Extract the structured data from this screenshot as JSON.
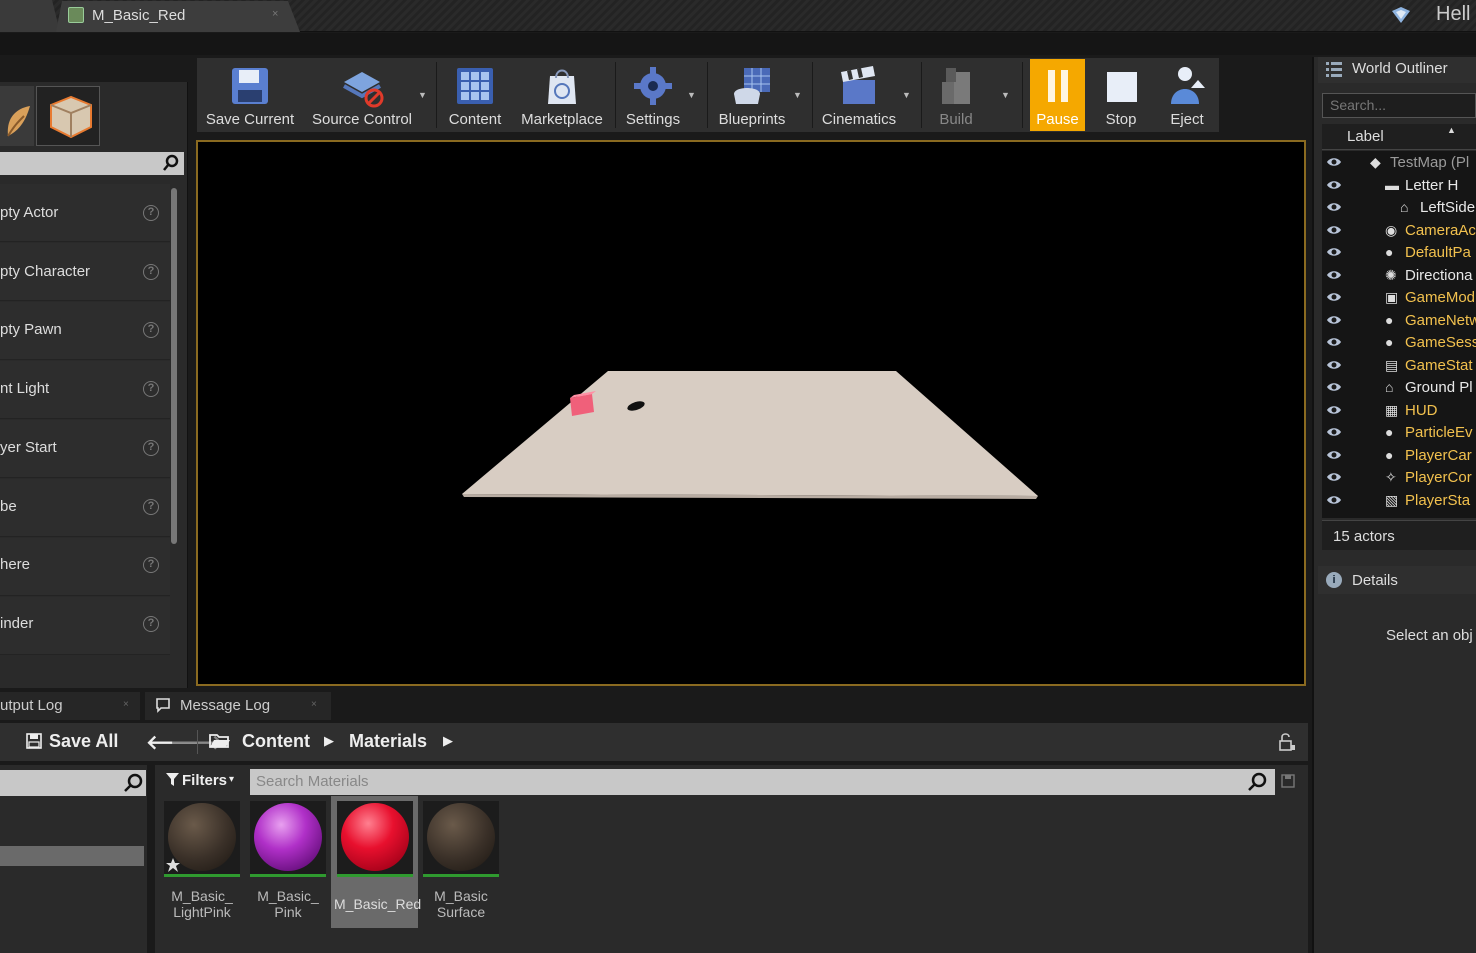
{
  "window": {
    "tab_title": "M_Basic_Red",
    "tab_close": "×",
    "user_greeting": "Hell"
  },
  "modes": {
    "items": [
      {
        "label": "pty Actor"
      },
      {
        "label": "pty Character"
      },
      {
        "label": "pty Pawn"
      },
      {
        "label": "nt Light"
      },
      {
        "label": "yer Start"
      },
      {
        "label": "be"
      },
      {
        "label": "here"
      },
      {
        "label": "inder"
      }
    ],
    "help_glyph": "?"
  },
  "toolbar": {
    "save_current": "Save Current",
    "source_control": "Source Control",
    "content": "Content",
    "marketplace": "Marketplace",
    "settings": "Settings",
    "blueprints": "Blueprints",
    "cinematics": "Cinematics",
    "build": "Build",
    "pause": "Pause",
    "stop": "Stop",
    "eject": "Eject",
    "dropdown_glyph": "▼"
  },
  "outliner": {
    "title": "World Outliner",
    "search_placeholder": "Search...",
    "column_label": "Label",
    "sort_glyph": "▲",
    "rows": [
      {
        "label": "TestMap (Pl",
        "icon": "map-icon",
        "color": "#9a9a9a"
      },
      {
        "label": "Letter H",
        "icon": "folder-icon",
        "color": "#e8e8e8"
      },
      {
        "label": "LeftSide",
        "icon": "actor-icon",
        "color": "#e8e8e8"
      },
      {
        "label": "CameraAc",
        "icon": "camera-icon",
        "color": "#f2c14e"
      },
      {
        "label": "DefaultPa",
        "icon": "pawn-icon",
        "color": "#f2c14e"
      },
      {
        "label": "Directiona",
        "icon": "sun-icon",
        "color": "#e8e8e8"
      },
      {
        "label": "GameMod",
        "icon": "gamemode-icon",
        "color": "#f2c14e"
      },
      {
        "label": "GameNetw",
        "icon": "sphere-icon",
        "color": "#f2c14e"
      },
      {
        "label": "GameSess",
        "icon": "sphere-icon",
        "color": "#f2c14e"
      },
      {
        "label": "GameStat",
        "icon": "chart-icon",
        "color": "#f2c14e"
      },
      {
        "label": "Ground Pl",
        "icon": "actor-icon",
        "color": "#e8e8e8"
      },
      {
        "label": "HUD",
        "icon": "hud-icon",
        "color": "#f2c14e"
      },
      {
        "label": "ParticleEv",
        "icon": "sphere-icon",
        "color": "#f2c14e"
      },
      {
        "label": "PlayerCar",
        "icon": "sphere-icon",
        "color": "#f2c14e"
      },
      {
        "label": "PlayerCor",
        "icon": "controller-icon",
        "color": "#f2c14e"
      },
      {
        "label": "PlayerSta",
        "icon": "state-icon",
        "color": "#f2c14e"
      }
    ],
    "actor_count": "15 actors"
  },
  "details": {
    "title": "Details",
    "empty_message": "Select an obj"
  },
  "bottom_tabs": {
    "output_log": "utput Log",
    "message_log": "Message Log",
    "close_glyph": "×"
  },
  "content_browser": {
    "save_all": "Save All",
    "back_glyph": "🡐",
    "forward_glyph": "🡒",
    "breadcrumb": [
      "Content",
      "Materials"
    ],
    "arrow_glyph": "▶",
    "filters": "Filters",
    "filters_caret": "▾",
    "search_placeholder": "Search Materials",
    "assets": [
      {
        "label": "M_Basic_\nLightPink",
        "color": "#3a3028"
      },
      {
        "label": "M_Basic_\nPink",
        "color": "#9a20b0"
      },
      {
        "label": "M_Basic_Red",
        "color": "#e01030"
      },
      {
        "label": "M_Basic\nSurface",
        "color": "#3a3028"
      }
    ]
  },
  "colors": {
    "accent_pause": "#f5a800",
    "viewport_border": "#8a6a20",
    "asset_underline": "#2f9a2f",
    "floor": "#d8cdc3",
    "cube": "#f0607a"
  }
}
